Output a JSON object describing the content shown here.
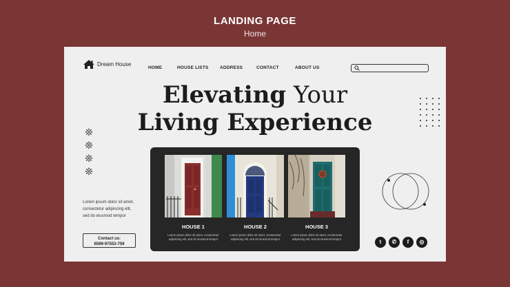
{
  "page": {
    "title": "LANDING PAGE",
    "subtitle": "Home"
  },
  "brand": {
    "name": "Dream House",
    "icon": "house-icon"
  },
  "nav": [
    "HOME",
    "HOUSE LISTS",
    "ADDRESS",
    "CONTACT",
    "ABOUT US"
  ],
  "search": {
    "placeholder": "",
    "icon": "search-icon"
  },
  "hero": {
    "line1_bold": "Elevating",
    "line1_light": "Your",
    "line2": "Living Experience"
  },
  "side_text": "Lorem ipsum dolor sit amet, consectetur adipiscing elit, sed do eiusmod tempor",
  "contact": {
    "label": "Contact us:",
    "phone": "6599-97553-759"
  },
  "houses": [
    {
      "name": "HOUSE 1",
      "desc": "Lorem ipsum dolor sit amet, consectetur adipiscing elit, sed do eiusmod tempor"
    },
    {
      "name": "HOUSE 2",
      "desc": "Lorem ipsum dolor sit amet, consectetur adipiscing elit, sed do eiusmod tempor"
    },
    {
      "name": "HOUSE 3",
      "desc": "Lorem ipsum dolor sit amet, consectetur adipiscing elit, sed do eiusmod tempor"
    }
  ],
  "socials": [
    "twitter-icon",
    "whatsapp-icon",
    "facebook-icon",
    "instagram-icon"
  ],
  "colors": {
    "background": "#7a3535",
    "card": "#efefef",
    "panel": "#262626"
  }
}
